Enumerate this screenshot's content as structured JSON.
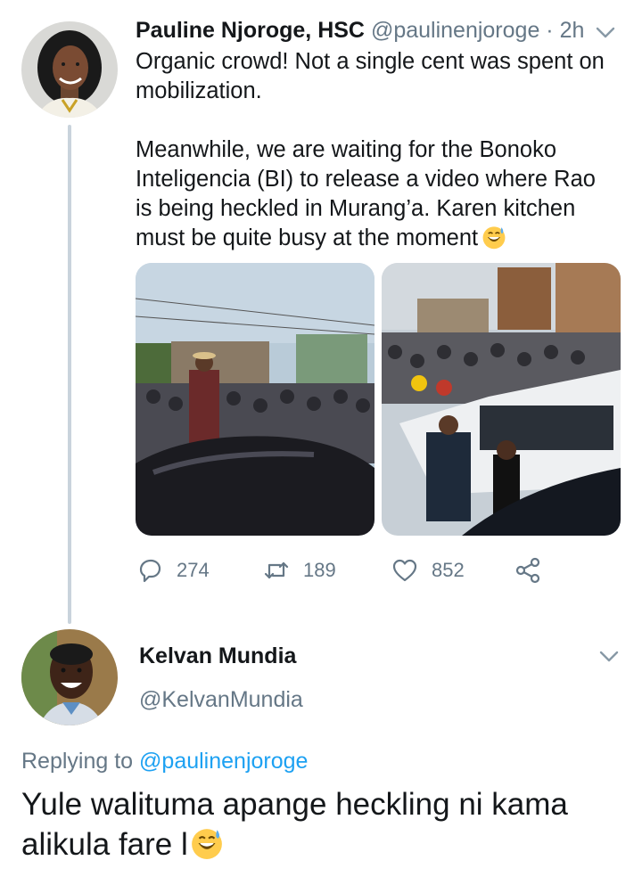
{
  "tweet": {
    "author_name": "Pauline Njoroge, HSC",
    "author_handle": "@paulinenjoroge",
    "separator": "·",
    "time": "2h",
    "paragraph1": "Organic crowd! Not a single cent was spent on mobilization.",
    "paragraph2": "Meanwhile, we are waiting for the Bonoko Inteligencia (BI) to release a video where Rao is being heckled in Murang’a. Karen kitchen must be quite busy at the moment",
    "emoji": "grinning-sweat-emoji",
    "media": [
      "crowd-photo-left",
      "crowd-photo-right"
    ],
    "actions": {
      "replies": "274",
      "retweets": "189",
      "likes": "852",
      "share_icon": "share-icon"
    }
  },
  "reply": {
    "author_name": "Kelvan Mundia",
    "author_handle": "@KelvanMundia",
    "replying_prefix": "Replying to",
    "replying_mention": "@paulinenjoroge",
    "text": "Yule walituma apange heckling ni kama alikula fare l",
    "emoji": "grinning-sweat-emoji"
  },
  "colors": {
    "text": "#14171a",
    "muted": "#657786",
    "link": "#1da1f2",
    "thread_line": "#c9d3dc"
  }
}
